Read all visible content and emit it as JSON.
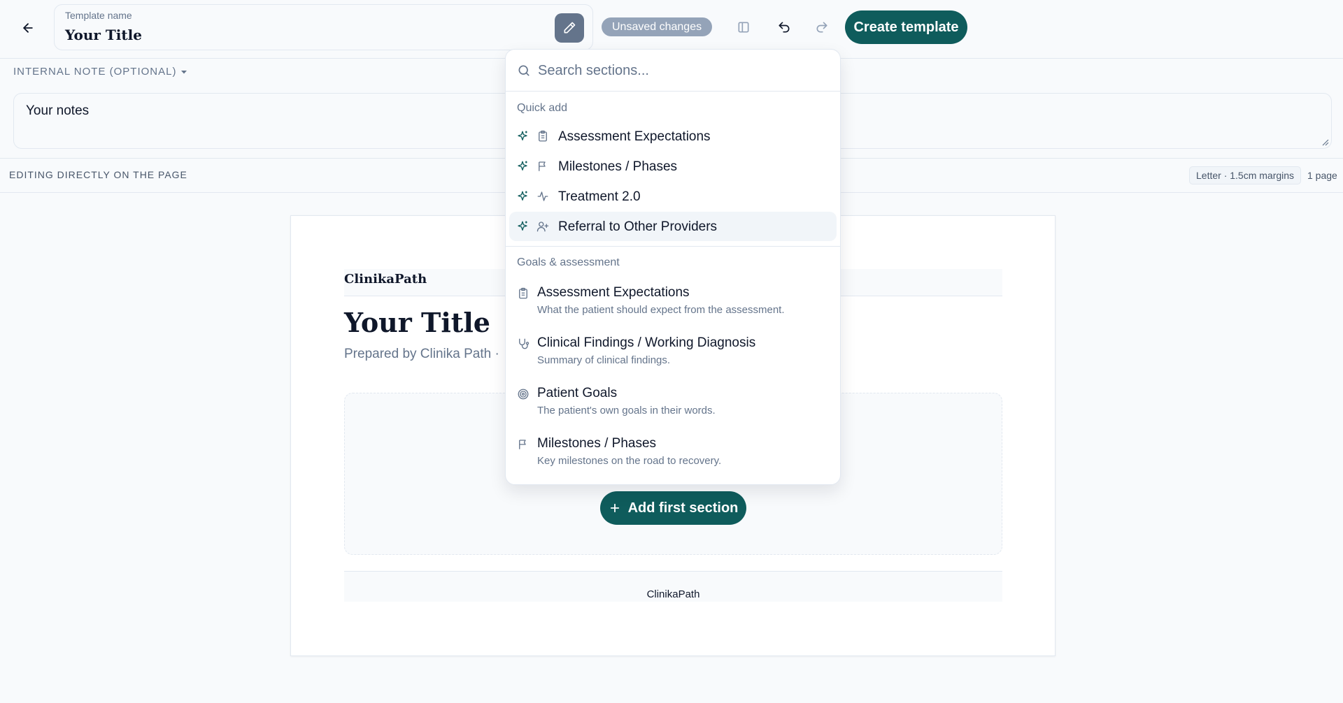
{
  "header": {
    "template_name_label": "Template name",
    "template_name_value": "Your Title",
    "unsaved_label": "Unsaved changes",
    "create_label": "Create template"
  },
  "note": {
    "toggle_label": "INTERNAL NOTE (OPTIONAL)",
    "value": "Your notes"
  },
  "editing_bar": {
    "label": "EDITING DIRECTLY ON THE PAGE",
    "paper_info": "Letter · 1.5cm margins",
    "page_count": "1 page"
  },
  "page": {
    "brand": "ClinikaPath",
    "title": "Your Title",
    "subtitle": "Prepared by Clinika Path ·",
    "add_first_label": "Add first section",
    "footer_brand": "ClinikaPath"
  },
  "dropdown": {
    "search_placeholder": "Search sections...",
    "quick_add_label": "Quick add",
    "quick_add": [
      {
        "label": "Assessment Expectations",
        "icon": "clipboard-icon"
      },
      {
        "label": "Milestones / Phases",
        "icon": "flag-icon"
      },
      {
        "label": "Treatment 2.0",
        "icon": "activity-icon"
      },
      {
        "label": "Referral to Other Providers",
        "icon": "user-plus-icon"
      }
    ],
    "group_label": "Goals & assessment",
    "group_items": [
      {
        "title": "Assessment Expectations",
        "desc": "What the patient should expect from the assessment.",
        "icon": "clipboard-icon"
      },
      {
        "title": "Clinical Findings / Working Diagnosis",
        "desc": "Summary of clinical findings.",
        "icon": "stethoscope-icon"
      },
      {
        "title": "Patient Goals",
        "desc": "The patient's own goals in their words.",
        "icon": "target-icon"
      },
      {
        "title": "Milestones / Phases",
        "desc": "Key milestones on the road to recovery.",
        "icon": "flag-icon"
      }
    ]
  },
  "colors": {
    "primary": "#0f5c5c",
    "badge": "#94a3b8",
    "edit_button": "#64748b",
    "background": "#f8fafc"
  }
}
